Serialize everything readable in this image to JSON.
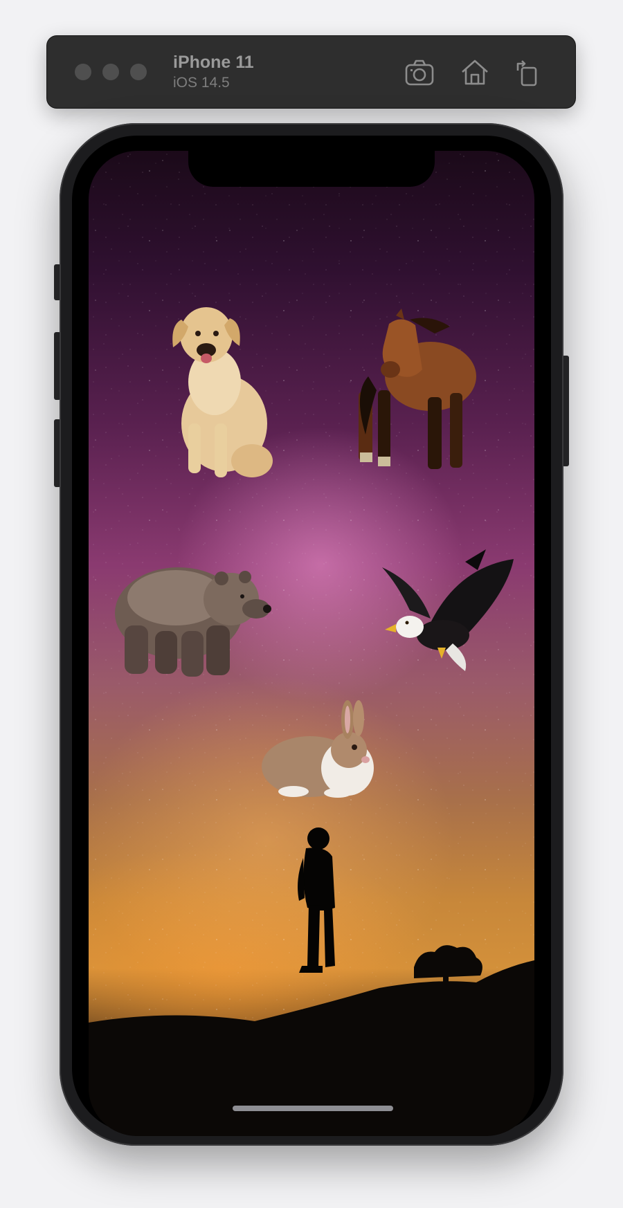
{
  "simulator": {
    "device_name": "iPhone 11",
    "os_version": "iOS 14.5",
    "toolbar_icons": [
      "screenshot-icon",
      "home-icon",
      "rotate-icon"
    ]
  },
  "screen": {
    "background": "starry-night-sky",
    "sprites": [
      "dog",
      "horse",
      "bear",
      "eagle",
      "rabbit",
      "person-silhouette"
    ]
  },
  "colors": {
    "toolbar_bg": "#2e2e2e",
    "toolbar_text": "#9a9a9a",
    "phone_frame": "#1c1c1e"
  }
}
